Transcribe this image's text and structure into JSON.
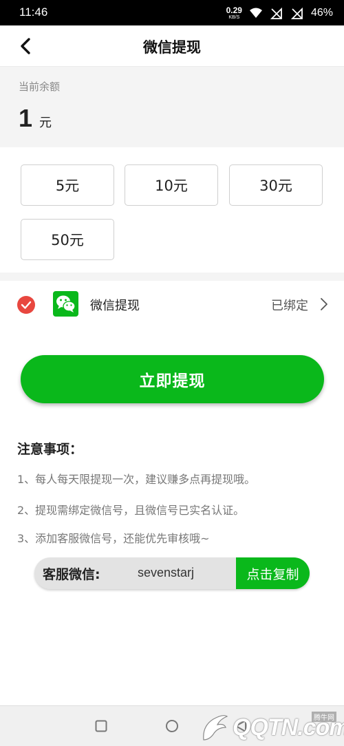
{
  "status_bar": {
    "time": "11:46",
    "net_speed_value": "0.29",
    "net_speed_unit": "KB/S",
    "battery": "46%",
    "icons": [
      "wifi-icon",
      "no-signal-icon",
      "no-signal-icon"
    ]
  },
  "header": {
    "title": "微信提现",
    "back_icon": "chevron-left-icon"
  },
  "balance": {
    "label": "当前余额",
    "amount": "1",
    "unit": "元"
  },
  "amount_options": [
    {
      "label": "5元"
    },
    {
      "label": "10元"
    },
    {
      "label": "30元"
    },
    {
      "label": "50元"
    }
  ],
  "payment_method": {
    "name": "微信提现",
    "status": "已绑定",
    "selected": true,
    "icon": "wechat-icon"
  },
  "withdraw_button": {
    "label": "立即提现"
  },
  "notes": {
    "title": "注意事项：",
    "items": [
      "1、每人每天限提现一次，建议赚多点再提现哦。",
      "2、提现需绑定微信号，且微信号已实名认证。",
      "3、添加客服微信号，还能优先审核哦~"
    ]
  },
  "customer_service": {
    "label": "客服微信:",
    "wechat_id": "sevenstarj",
    "copy_label": "点击复制"
  },
  "watermark": {
    "text": "QQTN.com",
    "sub": "腾牛网"
  },
  "colors": {
    "accent_green": "#0ab81b",
    "check_red": "#e8473f",
    "background_grey": "#f4f4f4"
  }
}
